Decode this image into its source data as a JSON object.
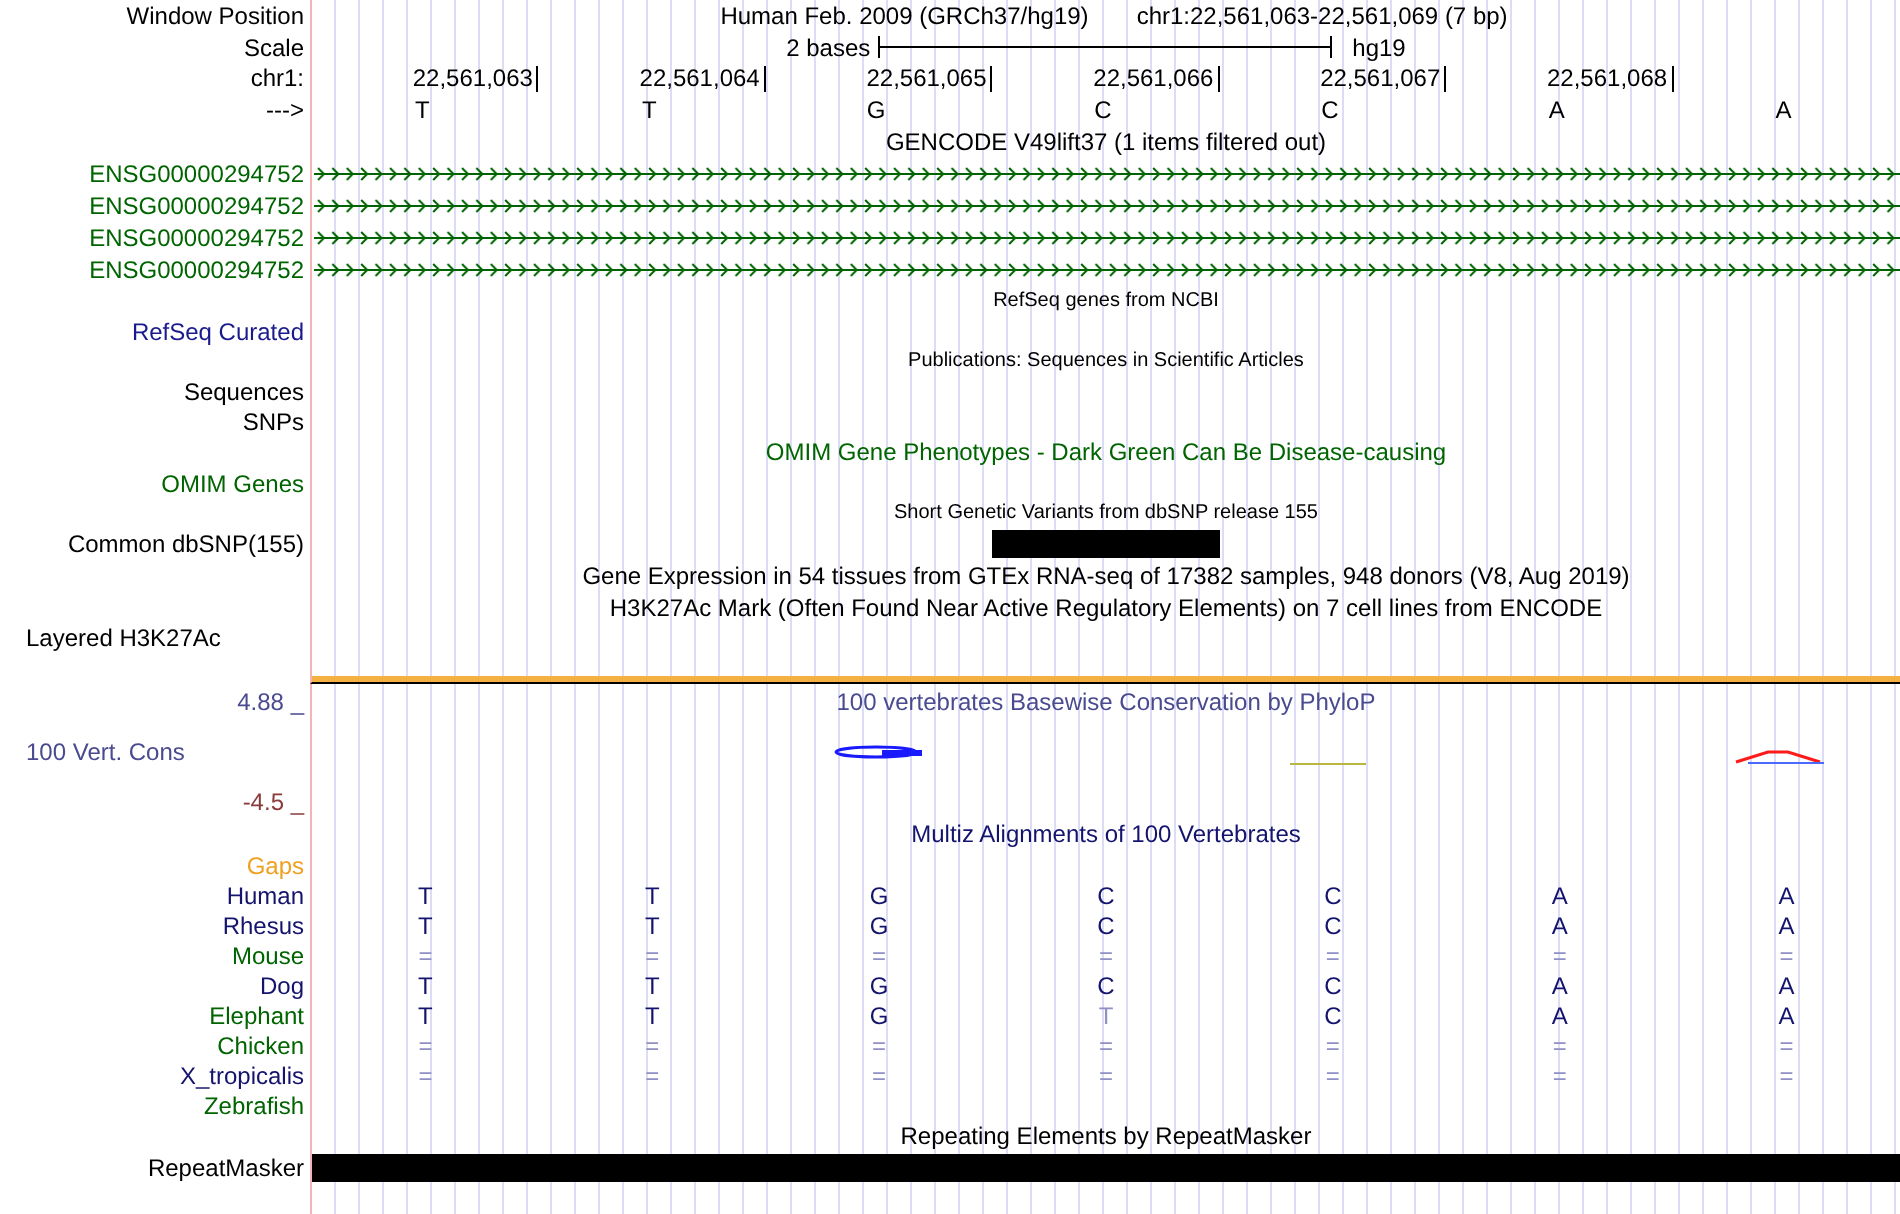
{
  "header": {
    "window_label": "Window Position",
    "assembly": "Human Feb. 2009 (GRCh37/hg19)",
    "position": "chr1:22,561,063-22,561,069 (7 bp)",
    "scale_label": "Scale",
    "scale_text": "2 bases",
    "scale_db": "hg19",
    "chrom_label": "chr1:",
    "strand_label": "--->"
  },
  "ruler": [
    "22,561,063",
    "22,561,064",
    "22,561,065",
    "22,561,066",
    "22,561,067",
    "22,561,068"
  ],
  "sequence": [
    "T",
    "T",
    "G",
    "C",
    "C",
    "A",
    "A"
  ],
  "rows": [
    {
      "kind": "title",
      "title": "GENCODE V49lift37 (1 items filtered out)",
      "color": "#000000"
    },
    {
      "kind": "gene",
      "label": "ENSG00000294752",
      "color": "#006400"
    },
    {
      "kind": "gene",
      "label": "ENSG00000294752",
      "color": "#006400"
    },
    {
      "kind": "gene",
      "label": "ENSG00000294752",
      "color": "#006400"
    },
    {
      "kind": "gene",
      "label": "ENSG00000294752",
      "color": "#006400"
    },
    {
      "kind": "small_title",
      "title": "RefSeq genes from NCBI",
      "color": "#000000"
    },
    {
      "kind": "label",
      "label": "RefSeq Curated",
      "color": "#1a1a8c"
    },
    {
      "kind": "small_title",
      "title": "Publications: Sequences in Scientific Articles",
      "color": "#000000"
    },
    {
      "kind": "label",
      "label": "Sequences",
      "color": "#000000"
    },
    {
      "kind": "label",
      "label": "SNPs",
      "color": "#000000"
    },
    {
      "kind": "title",
      "title": "OMIM Gene Phenotypes - Dark Green Can Be Disease-causing",
      "color": "#006400"
    },
    {
      "kind": "label",
      "label": "OMIM Genes",
      "color": "#006400"
    },
    {
      "kind": "small_title",
      "title": "Short Genetic Variants from dbSNP release 155",
      "color": "#000000"
    },
    {
      "kind": "variant_bar",
      "label": "Common dbSNP(155)",
      "color": "#000000"
    },
    {
      "kind": "title",
      "title": "Gene Expression in 54 tissues from GTEx RNA-seq of 17382 samples, 948 donors (V8, Aug 2019)",
      "color": "#000000"
    },
    {
      "kind": "title",
      "title": "H3K27Ac Mark (Often Found Near Active Regulatory Elements) on 7 cell lines from ENCODE",
      "color": "#000000"
    },
    {
      "kind": "layered",
      "label": "Layered H3K27Ac",
      "color": "#000000"
    },
    {
      "kind": "divider"
    },
    {
      "kind": "axis",
      "label": "4.88 _",
      "title": "100 vertebrates Basewise Conservation by PhyloP",
      "color": "#4a4a90"
    },
    {
      "kind": "conservation",
      "label": "100 Vert. Cons",
      "color": "#4a4a90"
    },
    {
      "kind": "axis",
      "label": "-4.5 _",
      "color": "#8b3a3a"
    },
    {
      "kind": "title",
      "title": "Multiz Alignments of 100 Vertebrates",
      "color": "#14146e"
    },
    {
      "kind": "label",
      "label": "Gaps",
      "color": "#f0a020"
    },
    {
      "kind": "alignment",
      "label": "Human",
      "color": "#14146e",
      "bases": [
        {
          "base": "T",
          "dim": false
        },
        {
          "base": "T",
          "dim": false
        },
        {
          "base": "G",
          "dim": false
        },
        {
          "base": "C",
          "dim": false
        },
        {
          "base": "C",
          "dim": false
        },
        {
          "base": "A",
          "dim": false
        },
        {
          "base": "A",
          "dim": false
        }
      ]
    },
    {
      "kind": "alignment",
      "label": "Rhesus",
      "color": "#14146e",
      "bases": [
        {
          "base": "T",
          "dim": false
        },
        {
          "base": "T",
          "dim": false
        },
        {
          "base": "G",
          "dim": false
        },
        {
          "base": "C",
          "dim": false
        },
        {
          "base": "C",
          "dim": false
        },
        {
          "base": "A",
          "dim": false
        },
        {
          "base": "A",
          "dim": false
        }
      ]
    },
    {
      "kind": "alignment",
      "label": "Mouse",
      "color": "#006400",
      "bases": [
        {
          "base": "=",
          "dim": true
        },
        {
          "base": "=",
          "dim": true
        },
        {
          "base": "=",
          "dim": true
        },
        {
          "base": "=",
          "dim": true
        },
        {
          "base": "=",
          "dim": true
        },
        {
          "base": "=",
          "dim": true
        },
        {
          "base": "=",
          "dim": true
        }
      ]
    },
    {
      "kind": "alignment",
      "label": "Dog",
      "color": "#14146e",
      "bases": [
        {
          "base": "T",
          "dim": false
        },
        {
          "base": "T",
          "dim": false
        },
        {
          "base": "G",
          "dim": false
        },
        {
          "base": "C",
          "dim": false
        },
        {
          "base": "C",
          "dim": false
        },
        {
          "base": "A",
          "dim": false
        },
        {
          "base": "A",
          "dim": false
        }
      ]
    },
    {
      "kind": "alignment",
      "label": "Elephant",
      "color": "#006400",
      "bases": [
        {
          "base": "T",
          "dim": false
        },
        {
          "base": "T",
          "dim": false
        },
        {
          "base": "G",
          "dim": false
        },
        {
          "base": "T",
          "dim": true
        },
        {
          "base": "C",
          "dim": false
        },
        {
          "base": "A",
          "dim": false
        },
        {
          "base": "A",
          "dim": false
        }
      ]
    },
    {
      "kind": "alignment",
      "label": "Chicken",
      "color": "#006400",
      "bases": [
        {
          "base": "=",
          "dim": true
        },
        {
          "base": "=",
          "dim": true
        },
        {
          "base": "=",
          "dim": true
        },
        {
          "base": "=",
          "dim": true
        },
        {
          "base": "=",
          "dim": true
        },
        {
          "base": "=",
          "dim": true
        },
        {
          "base": "=",
          "dim": true
        }
      ]
    },
    {
      "kind": "alignment",
      "label": "X_tropicalis",
      "color": "#14146e",
      "bases": [
        {
          "base": "=",
          "dim": true
        },
        {
          "base": "=",
          "dim": true
        },
        {
          "base": "=",
          "dim": true
        },
        {
          "base": "=",
          "dim": true
        },
        {
          "base": "=",
          "dim": true
        },
        {
          "base": "=",
          "dim": true
        },
        {
          "base": "=",
          "dim": true
        }
      ]
    },
    {
      "kind": "alignment",
      "label": "Zebrafish",
      "color": "#006400"
    },
    {
      "kind": "title",
      "title": "Repeating Elements by RepeatMasker",
      "color": "#000000"
    },
    {
      "kind": "repeat_bar",
      "label": "RepeatMasker",
      "color": "#000000"
    }
  ]
}
